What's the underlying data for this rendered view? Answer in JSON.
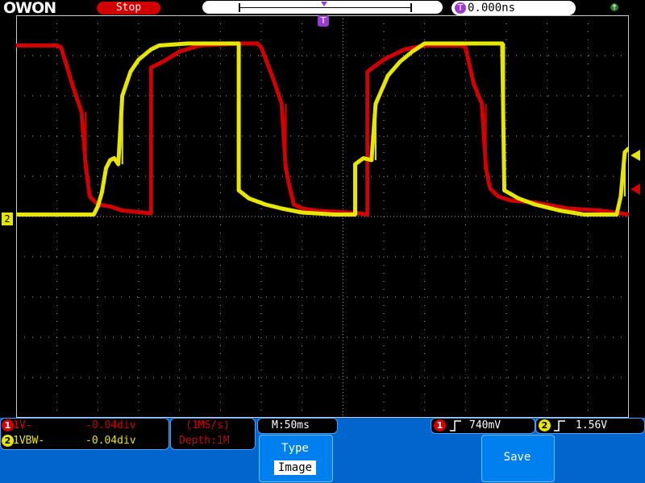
{
  "header": {
    "brand": "OWON",
    "run_state": "Stop",
    "trigger_position": "0.000ns",
    "trigger_icon": "T",
    "usb_icon": "usb-icon"
  },
  "markers": {
    "trigger_marker": "T",
    "ch2_marker": "2"
  },
  "channels": [
    {
      "num": "1",
      "coupling": "1V-",
      "offset": "-0.04div",
      "color": "#d20000"
    },
    {
      "num": "2",
      "coupling": "1VBW-",
      "offset": "-0.04div",
      "color": "#e6e600"
    }
  ],
  "acquisition": {
    "sample_rate": "(1MS/s)",
    "depth": "Depth:1M"
  },
  "timebase": "M:50ms",
  "triggers": [
    {
      "num": "1",
      "level": "740mV",
      "color": "#d20000"
    },
    {
      "num": "2",
      "level": "1.56V",
      "color": "#e6e600"
    }
  ],
  "softkeys": {
    "type_label": "Type",
    "type_value": "Image",
    "save_label": "Save"
  },
  "chart_data": {
    "type": "line",
    "title": "",
    "xlabel": "",
    "ylabel": "",
    "grid": true,
    "x_divisions": 15,
    "y_divisions": 10,
    "xlim": [
      -7.5,
      7.5
    ],
    "ylim": [
      -5,
      5
    ],
    "x_unit": "div",
    "y_unit": "div",
    "series": [
      {
        "name": "",
        "color": "#d20000",
        "points": [
          [
            -7.5,
            4.25
          ],
          [
            -6.5,
            4.25
          ],
          [
            -6.4,
            4.2
          ],
          [
            -6.1,
            3.2
          ],
          [
            -5.9,
            2.6
          ],
          [
            -5.8,
            1.3
          ],
          [
            -5.7,
            0.5
          ],
          [
            -5.5,
            0.3
          ],
          [
            -5.2,
            0.25
          ],
          [
            -4.9,
            0.15
          ],
          [
            -4.4,
            0.1
          ],
          [
            -4.2,
            0.08
          ],
          [
            -4.2,
            3.7
          ],
          [
            -3.9,
            3.85
          ],
          [
            -3.5,
            4.1
          ],
          [
            -3.0,
            4.25
          ],
          [
            -2.0,
            4.3
          ],
          [
            -1.6,
            4.3
          ],
          [
            -1.5,
            4.2
          ],
          [
            -1.2,
            3.4
          ],
          [
            -1.0,
            2.8
          ],
          [
            -0.9,
            1.2
          ],
          [
            -0.8,
            0.7
          ],
          [
            -0.7,
            0.3
          ],
          [
            -0.5,
            0.2
          ],
          [
            -0.2,
            0.15
          ],
          [
            0.6,
            0.1
          ],
          [
            0.9,
            0.08
          ],
          [
            1.1,
            0.05
          ],
          [
            1.1,
            3.6
          ],
          [
            1.5,
            3.9
          ],
          [
            2.0,
            4.15
          ],
          [
            2.5,
            4.25
          ],
          [
            3.4,
            4.25
          ],
          [
            3.5,
            4.2
          ],
          [
            3.7,
            3.3
          ],
          [
            3.9,
            2.8
          ],
          [
            4.0,
            1.2
          ],
          [
            4.1,
            0.7
          ],
          [
            4.3,
            0.5
          ],
          [
            4.6,
            0.4
          ],
          [
            5.2,
            0.35
          ],
          [
            6.0,
            0.2
          ],
          [
            6.8,
            0.15
          ],
          [
            7.5,
            0.05
          ]
        ]
      },
      {
        "name": "",
        "color": "#e6e600",
        "points": [
          [
            -7.5,
            0.05
          ],
          [
            -5.6,
            0.05
          ],
          [
            -5.5,
            0.25
          ],
          [
            -5.4,
            0.6
          ],
          [
            -5.3,
            1.2
          ],
          [
            -5.2,
            1.4
          ],
          [
            -5.1,
            1.45
          ],
          [
            -5.0,
            1.3
          ],
          [
            -4.9,
            3.0
          ],
          [
            -4.7,
            3.6
          ],
          [
            -4.5,
            3.9
          ],
          [
            -4.2,
            4.15
          ],
          [
            -4.0,
            4.25
          ],
          [
            -3.3,
            4.3
          ],
          [
            -2.05,
            4.3
          ],
          [
            -2.05,
            0.65
          ],
          [
            -1.8,
            0.45
          ],
          [
            -1.4,
            0.3
          ],
          [
            -1.0,
            0.2
          ],
          [
            -0.5,
            0.1
          ],
          [
            0.3,
            0.05
          ],
          [
            0.8,
            0.05
          ],
          [
            0.8,
            1.3
          ],
          [
            1.0,
            1.45
          ],
          [
            1.2,
            1.4
          ],
          [
            1.3,
            2.8
          ],
          [
            1.6,
            3.5
          ],
          [
            1.9,
            3.85
          ],
          [
            2.2,
            4.1
          ],
          [
            2.5,
            4.3
          ],
          [
            4.4,
            4.3
          ],
          [
            4.45,
            0.65
          ],
          [
            4.8,
            0.45
          ],
          [
            5.2,
            0.3
          ],
          [
            5.8,
            0.15
          ],
          [
            6.4,
            0.05
          ],
          [
            7.2,
            0.05
          ],
          [
            7.3,
            0.5
          ],
          [
            7.4,
            1.6
          ],
          [
            7.5,
            1.7
          ]
        ]
      }
    ]
  }
}
